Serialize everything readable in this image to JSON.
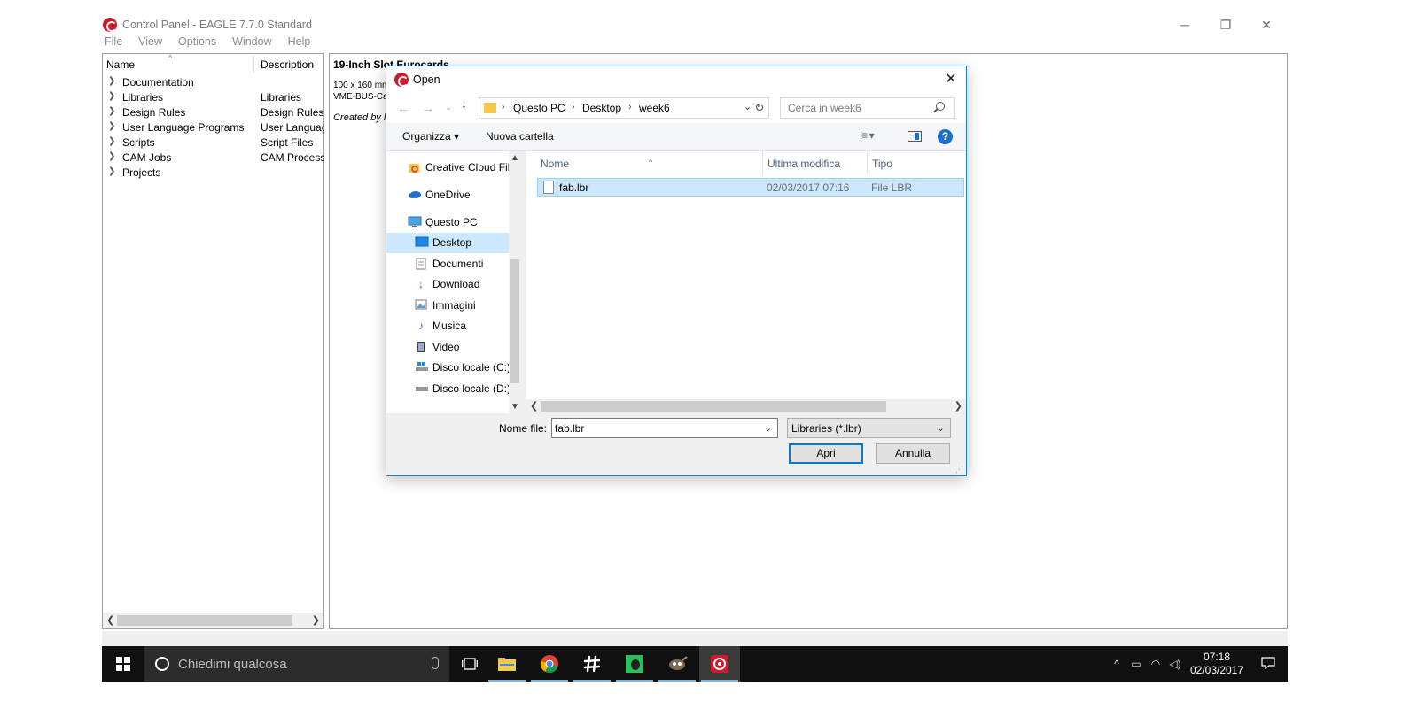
{
  "window": {
    "title": "Control Panel - EAGLE 7.7.0 Standard",
    "menu": [
      "File",
      "View",
      "Options",
      "Window",
      "Help"
    ],
    "controls": {
      "minimize": "─",
      "restore": "❐",
      "close": "✕"
    }
  },
  "tree": {
    "col_name": "Name",
    "col_description": "Description",
    "sort_indicator": "^",
    "items": [
      {
        "label": "Documentation",
        "desc": ""
      },
      {
        "label": "Libraries",
        "desc": "Libraries"
      },
      {
        "label": "Design Rules",
        "desc": "Design Rules"
      },
      {
        "label": "User Language Programs",
        "desc": "User Languag"
      },
      {
        "label": "Scripts",
        "desc": "Script Files"
      },
      {
        "label": "CAM Jobs",
        "desc": "CAM Processo"
      },
      {
        "label": "Projects",
        "desc": ""
      }
    ]
  },
  "description": {
    "title": "19-Inch Slot Eurocards",
    "line1": "100 x 160 mm",
    "line2": "VME-BUS-Ca",
    "created": "Created by l"
  },
  "dialog": {
    "title": "Open",
    "close": "✕",
    "breadcrumbs": [
      "Questo PC",
      "Desktop",
      "week6"
    ],
    "search_placeholder": "Cerca in week6",
    "organize": "Organizza ▾",
    "new_folder": "Nuova cartella",
    "help": "?",
    "nav_items": [
      {
        "label": "Creative Cloud Fil",
        "icon": "creative-cloud-icon"
      },
      {
        "label": "OneDrive",
        "icon": "onedrive-icon"
      },
      {
        "label": "Questo PC",
        "icon": "computer-icon"
      },
      {
        "label": "Desktop",
        "icon": "desktop-icon"
      },
      {
        "label": "Documenti",
        "icon": "documents-icon"
      },
      {
        "label": "Download",
        "icon": "download-icon"
      },
      {
        "label": "Immagini",
        "icon": "pictures-icon"
      },
      {
        "label": "Musica",
        "icon": "music-icon"
      },
      {
        "label": "Video",
        "icon": "video-icon"
      },
      {
        "label": "Disco locale (C:)",
        "icon": "drive-c-icon"
      },
      {
        "label": "Disco locale (D:)",
        "icon": "drive-d-icon"
      }
    ],
    "columns": {
      "name": "Nome",
      "modified": "Ultima modifica",
      "type": "Tipo"
    },
    "files": [
      {
        "name": "fab.lbr",
        "modified": "02/03/2017 07:16",
        "type": "File LBR"
      }
    ],
    "filename_label": "Nome file:",
    "filename_value": "fab.lbr",
    "filetype": "Libraries (*.lbr)",
    "open_button": "Apri",
    "cancel_button": "Annulla"
  },
  "taskbar": {
    "search_text": "Chiedimi qualcosa",
    "clock_time": "07:18",
    "clock_date": "02/03/2017"
  },
  "colors": {
    "accent": "#0078d7",
    "selection": "#cce8ff",
    "eagle_red": "#d11b2a",
    "taskbar": "#101010"
  }
}
